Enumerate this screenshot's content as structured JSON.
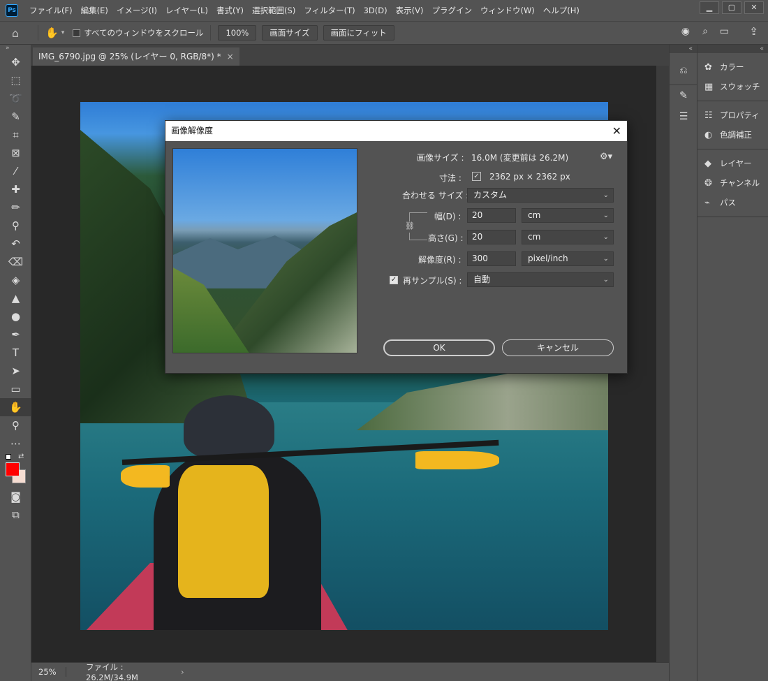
{
  "app": {
    "logo": "Ps",
    "menu": [
      "ファイル(F)",
      "編集(E)",
      "イメージ(I)",
      "レイヤー(L)",
      "書式(Y)",
      "選択範囲(S)",
      "フィルター(T)",
      "3D(D)",
      "表示(V)",
      "プラグイン",
      "ウィンドウ(W)",
      "ヘルプ(H)"
    ],
    "window_controls": [
      "minimize-icon",
      "restore-icon",
      "close-icon"
    ]
  },
  "options": {
    "scroll_all_label": "すべてのウィンドウをスクロール",
    "zoom_value": "100%",
    "fit_screen_label": "画面サイズ",
    "fill_screen_label": "画面にフィット"
  },
  "document": {
    "tab_title": "IMG_6790.jpg @ 25% (レイヤー 0, RGB/8*) *",
    "tab_close": "×"
  },
  "status": {
    "zoom": "25%",
    "file_info": "ファイル : 26.2M/34.9M",
    "arrow": "›"
  },
  "panels": {
    "group1": [
      {
        "icon": "palette-icon",
        "label": "カラー"
      },
      {
        "icon": "grid-icon",
        "label": "スウォッチ"
      }
    ],
    "group2": [
      {
        "icon": "sliders-icon",
        "label": "プロパティ"
      },
      {
        "icon": "half-circle-icon",
        "label": "色調補正"
      }
    ],
    "group3": [
      {
        "icon": "layers-icon",
        "label": "レイヤー"
      },
      {
        "icon": "channels-icon",
        "label": "チャンネル"
      },
      {
        "icon": "path-icon",
        "label": "パス"
      }
    ]
  },
  "dialog": {
    "title": "画像解像度",
    "image_size_label": "画像サイズ :",
    "image_size_value": "16.0M (変更前は 26.2M)",
    "dimensions_label": "寸法 :",
    "dimensions_value": "2362 px × 2362 px",
    "fit_to_label": "合わせる サイズ :",
    "fit_to_value": "カスタム",
    "width_label": "幅(D) :",
    "width_value": "20",
    "width_unit": "cm",
    "height_label": "高さ(G) :",
    "height_value": "20",
    "height_unit": "cm",
    "resolution_label": "解像度(R) :",
    "resolution_value": "300",
    "resolution_unit": "pixel/inch",
    "resample_label": "再サンプル(S) :",
    "resample_checked": true,
    "resample_value": "自動",
    "ok_label": "OK",
    "cancel_label": "キャンセル"
  }
}
